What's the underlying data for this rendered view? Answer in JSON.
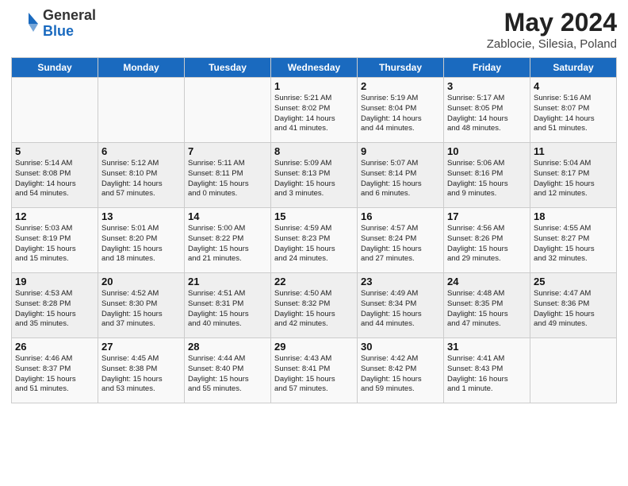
{
  "header": {
    "logo_general": "General",
    "logo_blue": "Blue",
    "title": "May 2024",
    "location": "Zablocie, Silesia, Poland"
  },
  "days_of_week": [
    "Sunday",
    "Monday",
    "Tuesday",
    "Wednesday",
    "Thursday",
    "Friday",
    "Saturday"
  ],
  "weeks": [
    [
      {
        "day": "",
        "info": ""
      },
      {
        "day": "",
        "info": ""
      },
      {
        "day": "",
        "info": ""
      },
      {
        "day": "1",
        "info": "Sunrise: 5:21 AM\nSunset: 8:02 PM\nDaylight: 14 hours\nand 41 minutes."
      },
      {
        "day": "2",
        "info": "Sunrise: 5:19 AM\nSunset: 8:04 PM\nDaylight: 14 hours\nand 44 minutes."
      },
      {
        "day": "3",
        "info": "Sunrise: 5:17 AM\nSunset: 8:05 PM\nDaylight: 14 hours\nand 48 minutes."
      },
      {
        "day": "4",
        "info": "Sunrise: 5:16 AM\nSunset: 8:07 PM\nDaylight: 14 hours\nand 51 minutes."
      }
    ],
    [
      {
        "day": "5",
        "info": "Sunrise: 5:14 AM\nSunset: 8:08 PM\nDaylight: 14 hours\nand 54 minutes."
      },
      {
        "day": "6",
        "info": "Sunrise: 5:12 AM\nSunset: 8:10 PM\nDaylight: 14 hours\nand 57 minutes."
      },
      {
        "day": "7",
        "info": "Sunrise: 5:11 AM\nSunset: 8:11 PM\nDaylight: 15 hours\nand 0 minutes."
      },
      {
        "day": "8",
        "info": "Sunrise: 5:09 AM\nSunset: 8:13 PM\nDaylight: 15 hours\nand 3 minutes."
      },
      {
        "day": "9",
        "info": "Sunrise: 5:07 AM\nSunset: 8:14 PM\nDaylight: 15 hours\nand 6 minutes."
      },
      {
        "day": "10",
        "info": "Sunrise: 5:06 AM\nSunset: 8:16 PM\nDaylight: 15 hours\nand 9 minutes."
      },
      {
        "day": "11",
        "info": "Sunrise: 5:04 AM\nSunset: 8:17 PM\nDaylight: 15 hours\nand 12 minutes."
      }
    ],
    [
      {
        "day": "12",
        "info": "Sunrise: 5:03 AM\nSunset: 8:19 PM\nDaylight: 15 hours\nand 15 minutes."
      },
      {
        "day": "13",
        "info": "Sunrise: 5:01 AM\nSunset: 8:20 PM\nDaylight: 15 hours\nand 18 minutes."
      },
      {
        "day": "14",
        "info": "Sunrise: 5:00 AM\nSunset: 8:22 PM\nDaylight: 15 hours\nand 21 minutes."
      },
      {
        "day": "15",
        "info": "Sunrise: 4:59 AM\nSunset: 8:23 PM\nDaylight: 15 hours\nand 24 minutes."
      },
      {
        "day": "16",
        "info": "Sunrise: 4:57 AM\nSunset: 8:24 PM\nDaylight: 15 hours\nand 27 minutes."
      },
      {
        "day": "17",
        "info": "Sunrise: 4:56 AM\nSunset: 8:26 PM\nDaylight: 15 hours\nand 29 minutes."
      },
      {
        "day": "18",
        "info": "Sunrise: 4:55 AM\nSunset: 8:27 PM\nDaylight: 15 hours\nand 32 minutes."
      }
    ],
    [
      {
        "day": "19",
        "info": "Sunrise: 4:53 AM\nSunset: 8:28 PM\nDaylight: 15 hours\nand 35 minutes."
      },
      {
        "day": "20",
        "info": "Sunrise: 4:52 AM\nSunset: 8:30 PM\nDaylight: 15 hours\nand 37 minutes."
      },
      {
        "day": "21",
        "info": "Sunrise: 4:51 AM\nSunset: 8:31 PM\nDaylight: 15 hours\nand 40 minutes."
      },
      {
        "day": "22",
        "info": "Sunrise: 4:50 AM\nSunset: 8:32 PM\nDaylight: 15 hours\nand 42 minutes."
      },
      {
        "day": "23",
        "info": "Sunrise: 4:49 AM\nSunset: 8:34 PM\nDaylight: 15 hours\nand 44 minutes."
      },
      {
        "day": "24",
        "info": "Sunrise: 4:48 AM\nSunset: 8:35 PM\nDaylight: 15 hours\nand 47 minutes."
      },
      {
        "day": "25",
        "info": "Sunrise: 4:47 AM\nSunset: 8:36 PM\nDaylight: 15 hours\nand 49 minutes."
      }
    ],
    [
      {
        "day": "26",
        "info": "Sunrise: 4:46 AM\nSunset: 8:37 PM\nDaylight: 15 hours\nand 51 minutes."
      },
      {
        "day": "27",
        "info": "Sunrise: 4:45 AM\nSunset: 8:38 PM\nDaylight: 15 hours\nand 53 minutes."
      },
      {
        "day": "28",
        "info": "Sunrise: 4:44 AM\nSunset: 8:40 PM\nDaylight: 15 hours\nand 55 minutes."
      },
      {
        "day": "29",
        "info": "Sunrise: 4:43 AM\nSunset: 8:41 PM\nDaylight: 15 hours\nand 57 minutes."
      },
      {
        "day": "30",
        "info": "Sunrise: 4:42 AM\nSunset: 8:42 PM\nDaylight: 15 hours\nand 59 minutes."
      },
      {
        "day": "31",
        "info": "Sunrise: 4:41 AM\nSunset: 8:43 PM\nDaylight: 16 hours\nand 1 minute."
      },
      {
        "day": "",
        "info": ""
      }
    ]
  ]
}
